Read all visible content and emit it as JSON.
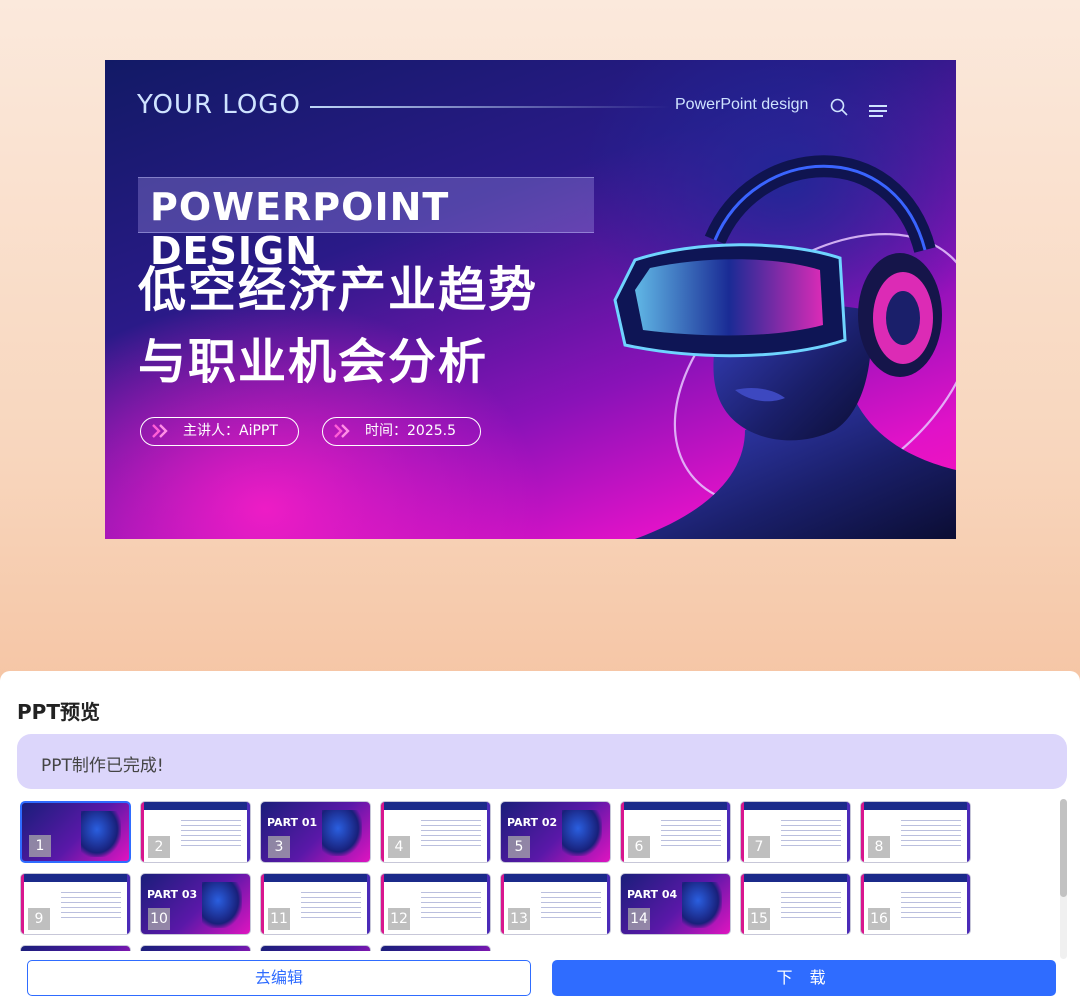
{
  "slide": {
    "logo": "YOUR LOGO",
    "nav_text": "PowerPoint design",
    "banner": "POWERPOINT DESIGN",
    "title_line1": "低空经济产业趋势",
    "title_line2": "与职业机会分析",
    "speaker": "主讲人：AiPPT",
    "time": "时间：2025.5",
    "icons": [
      "search-icon",
      "menu-icon",
      "double-chevron-icon"
    ]
  },
  "panel": {
    "title": "PPT预览",
    "status": "PPT制作已完成!",
    "thumbnails": [
      {
        "num": "1",
        "part": "",
        "sub": "",
        "style": "dark",
        "active": true
      },
      {
        "num": "2",
        "part": "",
        "sub": "",
        "style": "light",
        "active": false
      },
      {
        "num": "3",
        "part": "PART 01",
        "sub": "",
        "style": "dark",
        "active": false
      },
      {
        "num": "4",
        "part": "",
        "sub": "",
        "style": "light",
        "active": false
      },
      {
        "num": "5",
        "part": "PART 02",
        "sub": "",
        "style": "dark",
        "active": false
      },
      {
        "num": "6",
        "part": "",
        "sub": "",
        "style": "light",
        "active": false
      },
      {
        "num": "7",
        "part": "",
        "sub": "",
        "style": "light",
        "active": false
      },
      {
        "num": "8",
        "part": "",
        "sub": "",
        "style": "light",
        "active": false
      },
      {
        "num": "9",
        "part": "",
        "sub": "",
        "style": "light",
        "active": false
      },
      {
        "num": "10",
        "part": "PART 03",
        "sub": "",
        "style": "dark",
        "active": false
      },
      {
        "num": "11",
        "part": "",
        "sub": "",
        "style": "light",
        "active": false
      },
      {
        "num": "12",
        "part": "",
        "sub": "",
        "style": "light",
        "active": false
      },
      {
        "num": "13",
        "part": "",
        "sub": "",
        "style": "light",
        "active": false
      },
      {
        "num": "14",
        "part": "PART 04",
        "sub": "",
        "style": "dark",
        "active": false
      },
      {
        "num": "15",
        "part": "",
        "sub": "",
        "style": "light",
        "active": false
      },
      {
        "num": "16",
        "part": "",
        "sub": "",
        "style": "light",
        "active": false
      }
    ],
    "edit_button": "去编辑",
    "download_button": "下 载"
  },
  "colors": {
    "accent": "#2f6cff",
    "status_bg": "#dcd6fb",
    "slide_magenta": "#ff14b8",
    "slide_navy": "#121a66"
  }
}
